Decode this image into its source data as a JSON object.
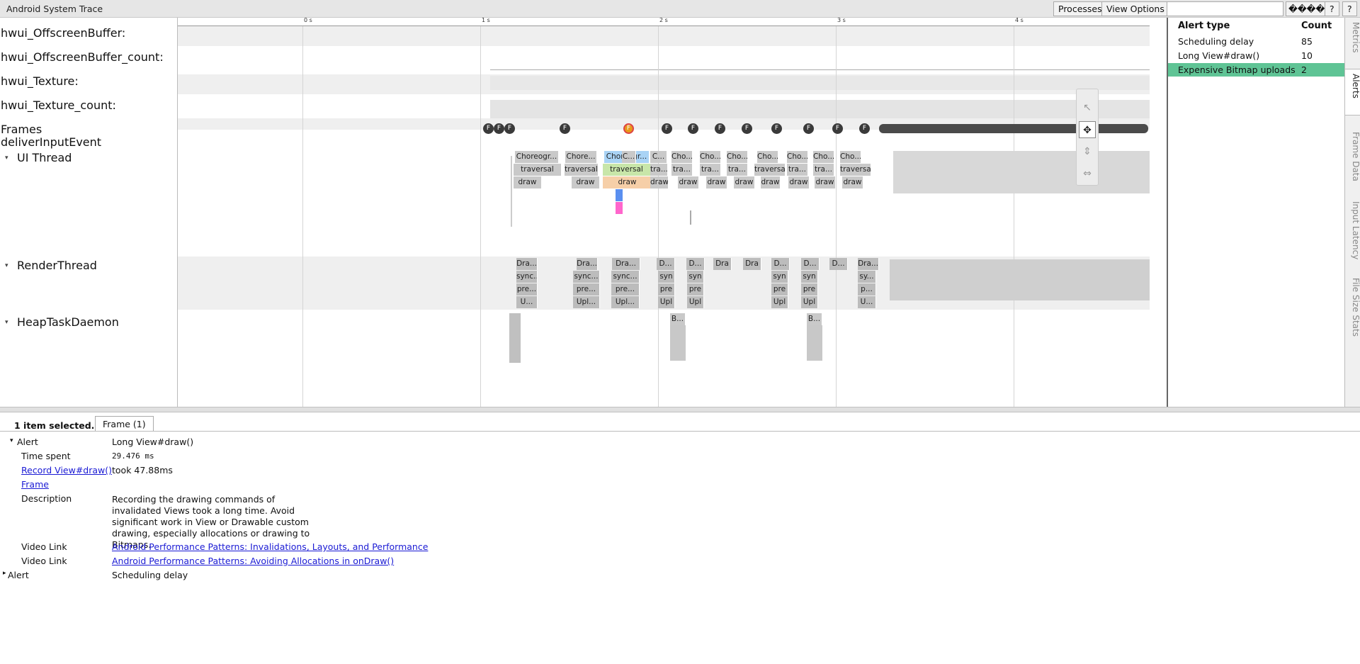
{
  "app": {
    "title": "Android System Trace",
    "buttons": {
      "processes": "Processes",
      "view_options": "View Options",
      "glyph": "����",
      "help1": "?",
      "help2": "?"
    },
    "search_placeholder": ""
  },
  "ruler": {
    "ticks": [
      "0 s",
      "1 s",
      "2 s",
      "3 s",
      "4 s"
    ]
  },
  "tracks": {
    "offscreen_buffer": "hwui_OffscreenBuffer:",
    "offscreen_buffer_count": "hwui_OffscreenBuffer_count:",
    "texture": "hwui_Texture:",
    "texture_count": "hwui_Texture_count:",
    "frames": "Frames",
    "deliver_input": "deliverInputEvent",
    "ui_thread": "UI Thread",
    "render_thread": "RenderThread",
    "heap_task": "HeapTaskDaemon",
    "expand_arrow": "▾"
  },
  "frame_marker": "F",
  "ui_slices": {
    "row1": [
      "Choreogr...",
      "Chore...",
      "Choreogr...",
      "C...",
      "Cho...",
      "Cho...",
      "Cho...",
      "Cho...",
      "Cho...",
      "Cho...",
      "Cho...",
      "Cho..."
    ],
    "row2": [
      "traversal",
      "traversal",
      "traversal",
      "tra...",
      "tra...",
      "tra...",
      "tra...",
      "traversal",
      "tra...",
      "tra...",
      "traversal"
    ],
    "row3": [
      "draw",
      "draw",
      "draw",
      "draw",
      "draw",
      "draw",
      "draw",
      "draw",
      "draw",
      "draw",
      "draw"
    ]
  },
  "render_slices": {
    "row1": [
      "Dra...",
      "Dra...",
      "Dra...",
      "D...",
      "D...",
      "Dra",
      "Dra",
      "D...",
      "D...",
      "D...",
      "Dra..."
    ],
    "row2": [
      "sync...",
      "sync...",
      "sync...",
      "syn",
      "syn",
      "syn",
      "syn",
      "sy..."
    ],
    "row3": [
      "pre...",
      "pre...",
      "pre...",
      "pre",
      "pre",
      "pre",
      "pre",
      "p..."
    ],
    "row4": [
      "U...",
      "Upl...",
      "Upl...",
      "Upl",
      "Upl",
      "Upl",
      "Upl",
      "U..."
    ]
  },
  "heap_slices": [
    "B...",
    "B..."
  ],
  "alerts_panel": {
    "col_type": "Alert type",
    "col_count": "Count",
    "rows": [
      {
        "type": "Scheduling delay",
        "count": "85"
      },
      {
        "type": "Long View#draw()",
        "count": "10"
      },
      {
        "type": "Expensive Bitmap uploads",
        "count": "2"
      }
    ]
  },
  "side_tabs": [
    "Metrics",
    "Alerts",
    "Frame Data",
    "Input Latency",
    "File Size Stats"
  ],
  "tools": {
    "select": "↖",
    "pan": "✥",
    "zoom": "⇕",
    "timing": "⇔"
  },
  "details": {
    "selection_count": "1 item selected.",
    "tab": "Frame (1)",
    "alert_label": "Alert",
    "alert_value": "Long View#draw()",
    "time_spent_label": "Time spent",
    "time_spent_value": "29.476 ms",
    "record_label": "Record View#draw()",
    "record_value": "took 47.88ms",
    "frame_label": "Frame",
    "description_label": "Description",
    "description_value": "Recording the drawing commands of invalidated Views took a long time. Avoid significant work in View or Drawable custom drawing, especially allocations or drawing to Bitmaps.",
    "video1_label": "Video Link",
    "video1_value": "Android Performance Patterns: Invalidations, Layouts, and Performance",
    "video2_label": "Video Link",
    "video2_value": "Android Performance Patterns: Avoiding Allocations in onDraw()",
    "alert2_label": "Alert",
    "alert2_value": "Scheduling delay",
    "collapsed_arrow": "▸"
  }
}
